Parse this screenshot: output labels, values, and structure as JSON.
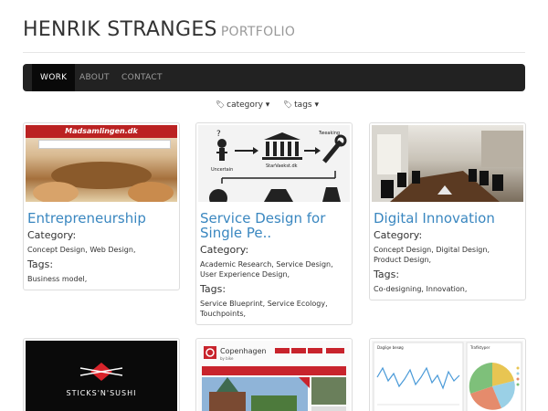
{
  "header": {
    "title": "HENRIK STRANGES",
    "subtitle": "PORTFOLIO"
  },
  "nav": {
    "items": [
      {
        "label": "WORK",
        "active": true
      },
      {
        "label": "ABOUT",
        "active": false
      },
      {
        "label": "CONTACT",
        "active": false
      }
    ]
  },
  "filters": {
    "category": "category ▾",
    "tags": "tags ▾"
  },
  "projects": [
    {
      "title": "Entrepreneurship",
      "category_label": "Category:",
      "category": "Concept Design, Web Design,",
      "tags_label": "Tags:",
      "tags": "Business model,",
      "thumb_text": "Madsamlingen.dk"
    },
    {
      "title": "Service Design for Single Pe..",
      "category_label": "Category:",
      "category": "Academic Research, Service Design, User Experience Design,",
      "tags_label": "Tags:",
      "tags": "Service Blueprint, Service Ecology, Touchpoints,",
      "thumb_text": [
        "Uncertain",
        "StarVaekst.dk",
        "Tweaking"
      ]
    },
    {
      "title": "Digital Innovation",
      "category_label": "Category:",
      "category": "Concept Design, Digital Design, Product Design,",
      "tags_label": "Tags:",
      "tags": "Co-designing, Innovation,"
    },
    {
      "thumb_text": "STICKS'N'SUSHI"
    },
    {
      "thumb_text": [
        "Copenhagen",
        "by bike"
      ]
    },
    {
      "thumb_text": [
        "Daglige besøg",
        "Trafiktyper"
      ]
    }
  ]
}
